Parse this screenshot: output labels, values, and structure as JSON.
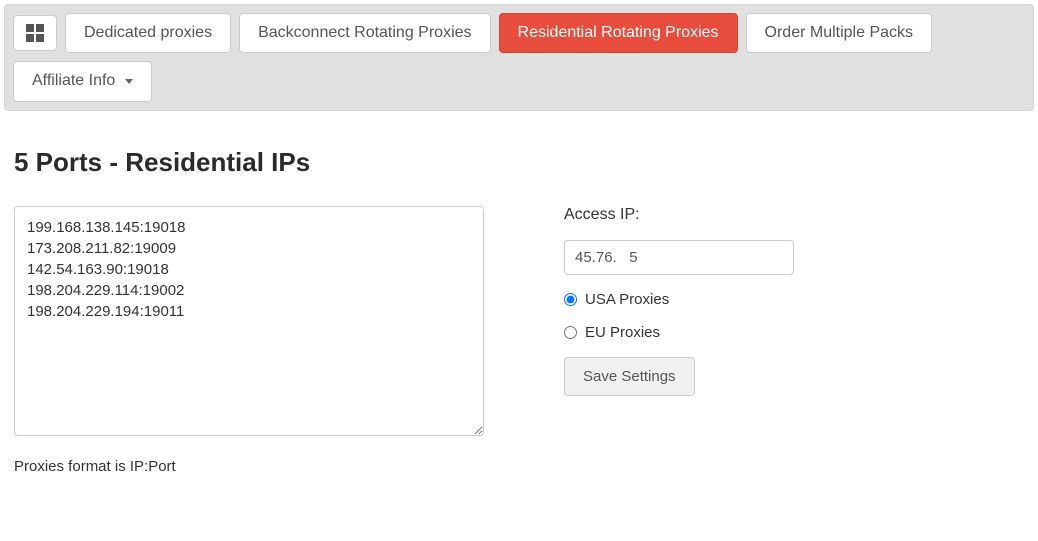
{
  "nav": {
    "dedicated": "Dedicated proxies",
    "backconnect": "Backconnect Rotating Proxies",
    "residential": "Residential Rotating Proxies",
    "order_multiple": "Order Multiple Packs",
    "affiliate": "Affiliate Info"
  },
  "page": {
    "title": "5 Ports - Residential IPs"
  },
  "proxies": {
    "list_text": "199.168.138.145:19018\n173.208.211.82:19009\n142.54.163.90:19018\n198.204.229.114:19002\n198.204.229.194:19011",
    "format_note": "Proxies format is IP:Port"
  },
  "access": {
    "label": "Access IP:",
    "ip_value": "45.76.   5"
  },
  "region": {
    "usa_label": "USA Proxies",
    "eu_label": "EU Proxies"
  },
  "actions": {
    "save_label": "Save Settings"
  }
}
